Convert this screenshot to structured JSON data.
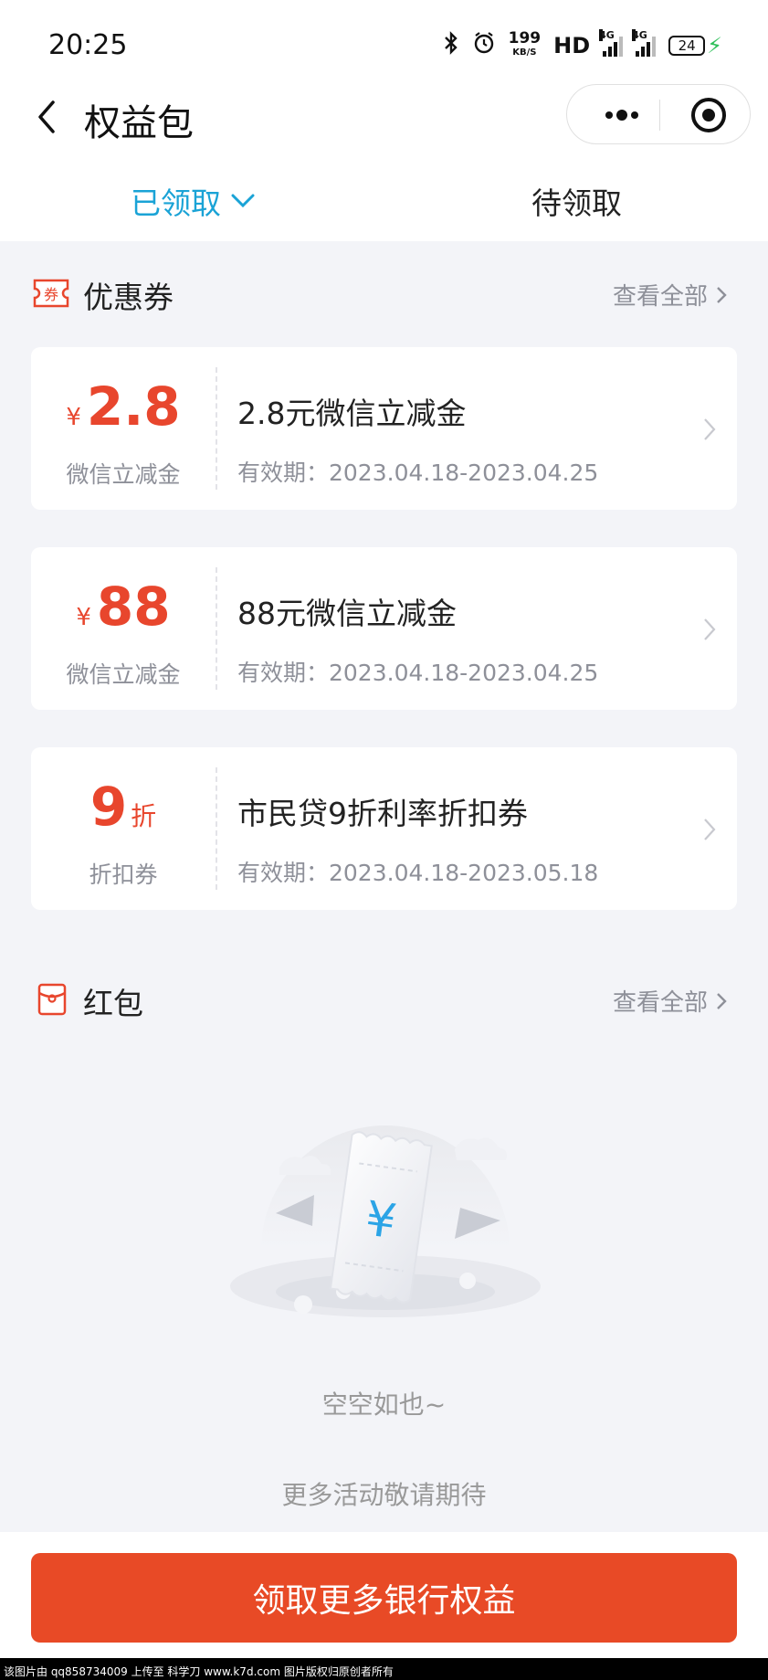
{
  "status_bar": {
    "time": "20:25",
    "net_speed": "199",
    "net_speed_unit": "KB/S",
    "hd": "HD",
    "sig1": "4G",
    "sig2": "4G",
    "battery": "24"
  },
  "nav": {
    "title": "权益包"
  },
  "tabs": {
    "received": "已领取",
    "pending": "待领取"
  },
  "coupons_section": {
    "title": "优惠券",
    "more": "查看全部",
    "items": [
      {
        "currency": "¥",
        "value": "2.8",
        "unit": "",
        "type": "微信立减金",
        "name": "2.8元微信立减金",
        "valid": "有效期：2023.04.18-2023.04.25"
      },
      {
        "currency": "¥",
        "value": "88",
        "unit": "",
        "type": "微信立减金",
        "name": "88元微信立减金",
        "valid": "有效期：2023.04.18-2023.04.25"
      },
      {
        "currency": "",
        "value": "9",
        "unit": "折",
        "type": "折扣券",
        "name": "市民贷9折利率折扣券",
        "valid": "有效期：2023.04.18-2023.05.18"
      }
    ]
  },
  "redpacket_section": {
    "title": "红包",
    "more": "查看全部",
    "empty_title": "空空如也~",
    "empty_sub": "更多活动敬请期待"
  },
  "cta": {
    "label": "领取更多银行权益"
  },
  "watermark": "该图片由 qq858734009 上传至 科学刀 www.k7d.com 图片版权归原创者所有",
  "colors": {
    "accent_blue": "#1aa3d6",
    "accent_red": "#e8462d",
    "cta_red": "#e84a26",
    "page_bg": "#f3f4f8"
  }
}
